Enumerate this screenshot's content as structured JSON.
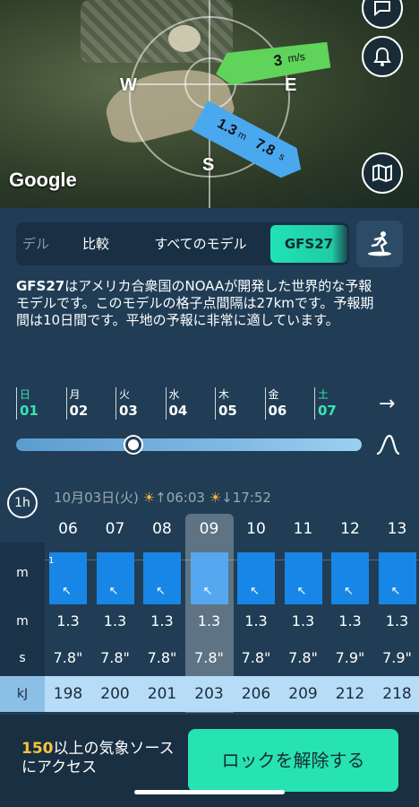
{
  "map": {
    "compass": {
      "w": "W",
      "e": "E",
      "s": "S"
    },
    "wind": {
      "speed": "3",
      "unit": "m/s"
    },
    "swell": {
      "height": "1.3",
      "height_unit": "m",
      "period": "7.8",
      "period_unit": "s"
    },
    "logo": "Google",
    "buttons": {
      "chat": "chat-icon",
      "bell": "bell-icon",
      "map": "map-icon"
    }
  },
  "model_tabs": [
    "デル",
    "比較",
    "すべてのモデル",
    "GFS27"
  ],
  "model_description": {
    "bold": "GFS27",
    "text": "はアメリカ合衆国のNOAAが開発した世界的な予報モデルです。このモデルの格子点間隔は27kmです。予報期間は10日間です。平地の予報に非常に適しています。"
  },
  "days": [
    {
      "wd": "日",
      "dn": "01",
      "green": true
    },
    {
      "wd": "月",
      "dn": "02",
      "green": false
    },
    {
      "wd": "火",
      "dn": "03",
      "green": false
    },
    {
      "wd": "水",
      "dn": "04",
      "green": false
    },
    {
      "wd": "木",
      "dn": "05",
      "green": false
    },
    {
      "wd": "金",
      "dn": "06",
      "green": false
    },
    {
      "wd": "土",
      "dn": "07",
      "green": true
    }
  ],
  "slider": {
    "position_fraction": 0.34
  },
  "table": {
    "interval": "1h",
    "date": "10月03日(火)",
    "sunrise": "06:03",
    "sunset": "17:52",
    "row_labels": [
      "m",
      "m",
      "s",
      "kJ"
    ],
    "bar_scale_label": "1",
    "hours": [
      "06",
      "07",
      "08",
      "09",
      "10",
      "11",
      "12",
      "13"
    ],
    "selected_hour_index": 3,
    "wave_height": [
      "1.3",
      "1.3",
      "1.3",
      "1.3",
      "1.3",
      "1.3",
      "1.3",
      "1.3"
    ],
    "period": [
      "7.8\"",
      "7.8\"",
      "7.8\"",
      "7.8\"",
      "7.8\"",
      "7.8\"",
      "7.9\"",
      "7.9\""
    ],
    "energy": [
      "198",
      "200",
      "201",
      "203",
      "206",
      "209",
      "212",
      "218"
    ],
    "direction_glyph": "↖"
  },
  "footer": {
    "access_number": "150",
    "access_text": "以上の気象ソースにアクセス",
    "unlock_label": "ロックを解除する"
  },
  "colors": {
    "accent_green": "#26e3b1",
    "bar_blue": "#1886e6",
    "highlight_yellow": "#f5c53a"
  }
}
